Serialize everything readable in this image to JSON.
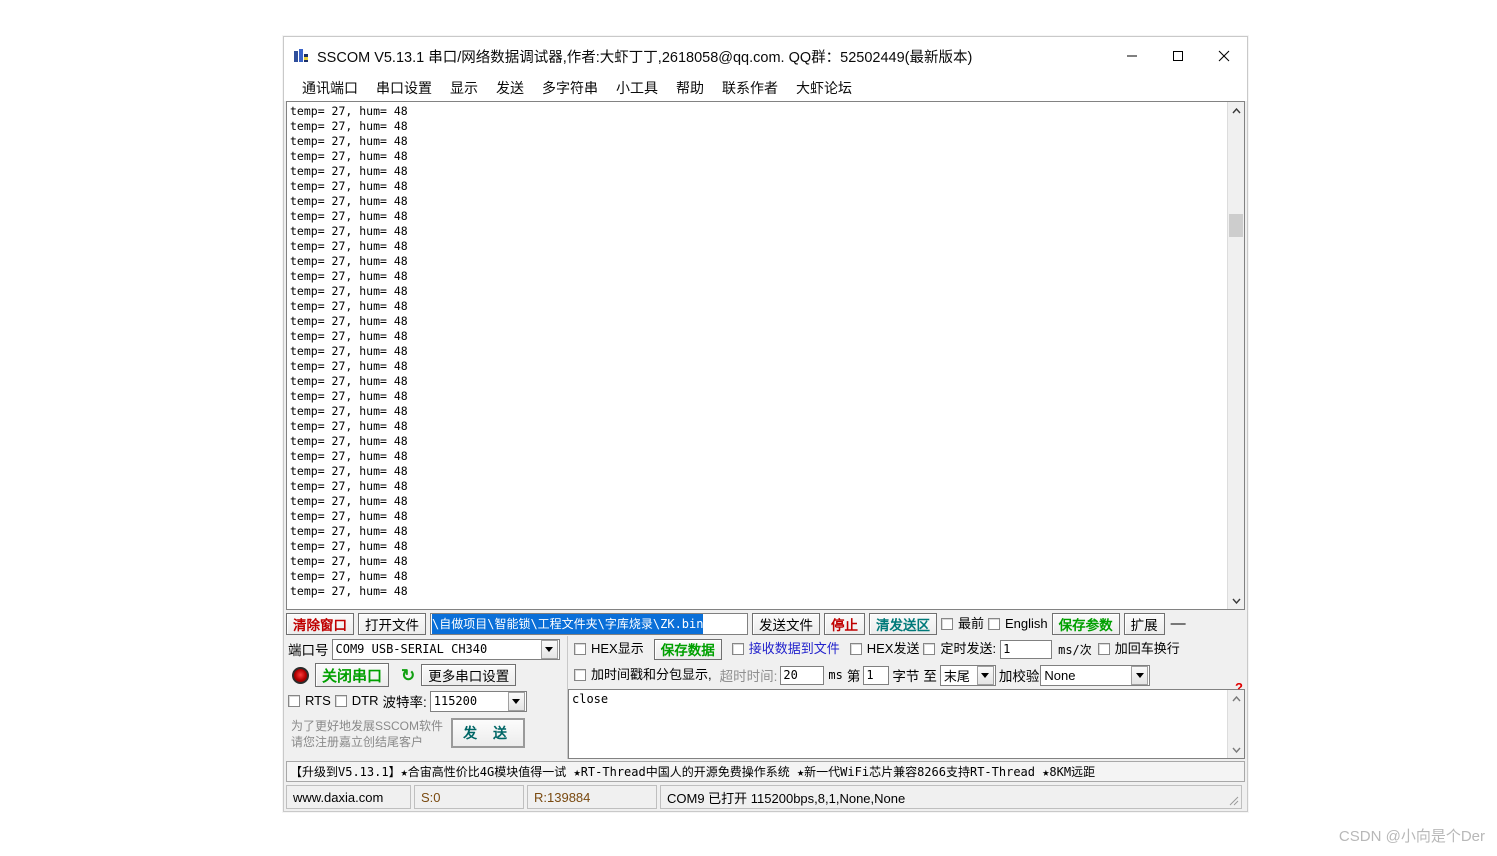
{
  "window": {
    "title": "SSCOM V5.13.1 串口/网络数据调试器,作者:大虾丁丁,2618058@qq.com. QQ群：52502449(最新版本)",
    "minimize": "−",
    "maximize": "□",
    "close": "✕"
  },
  "menu": {
    "items": [
      {
        "label": "通讯端口"
      },
      {
        "label": "串口设置"
      },
      {
        "label": "显示"
      },
      {
        "label": "发送"
      },
      {
        "label": "多字符串"
      },
      {
        "label": "小工具"
      },
      {
        "label": "帮助"
      },
      {
        "label": "联系作者"
      },
      {
        "label": "大虾论坛"
      }
    ]
  },
  "receive": {
    "line_text": "temp= 27, hum= 48",
    "line_count": 33,
    "scroll": {
      "up_arrow": "⌃",
      "down_arrow": "⌄",
      "thumb_top_pct": 20,
      "thumb_height_pct": 5
    }
  },
  "toolbar": {
    "clear_window": "清除窗口",
    "open_file": "打开文件",
    "file_path": "\\自做项目\\智能锁\\工程文件夹\\字库烧录\\ZK.bin",
    "send_file": "发送文件",
    "stop": "停止",
    "clear_send": "清发送区",
    "topmost": "最前",
    "english": "English",
    "save_params": "保存参数",
    "extend": "扩展",
    "collapse": "—"
  },
  "serial": {
    "port_label": "端口号",
    "port_value": "COM9  USB-SERIAL CH340",
    "close_port": "关闭串口",
    "more_settings": "更多串口设置",
    "rts": "RTS",
    "dtr": "DTR",
    "baud_label": "波特率:",
    "baud_value": "115200",
    "promo_line1": "为了更好地发展SSCOM软件",
    "promo_line2": "请您注册嘉立创结尾客户",
    "send_button": "发 送"
  },
  "options": {
    "hex_display": "HEX显示",
    "save_data": "保存数据",
    "recv_to_file": "接收数据到文件",
    "hex_send": "HEX发送",
    "timed_send": "定时发送:",
    "timed_value": "1",
    "timed_unit": "ms/次",
    "add_crlf": "加回车换行",
    "timestamp_pack": "加时间戳和分包显示,",
    "timeout_label": "超时时间:",
    "timeout_value": "20",
    "timeout_unit": "ms",
    "byte_prefix": "第",
    "byte_value": "1",
    "byte_mid": "字节",
    "byte_to": "至",
    "byte_end": "末尾",
    "checksum_label": "加校验",
    "checksum_value": "None",
    "question_mark": "?"
  },
  "send_area": {
    "text": "close"
  },
  "ad_strip": {
    "text": "【升级到V5.13.1】★合宙高性价比4G模块值得一试  ★RT-Thread中国人的开源免费操作系统  ★新一代WiFi芯片兼容8266支持RT-Thread ★8KM远距"
  },
  "status": {
    "site": "www.daxia.com",
    "sent": "S:0",
    "received": "R:139884",
    "connection": "COM9 已打开  115200bps,8,1,None,None"
  },
  "watermark": {
    "text": "CSDN @小向是个Der"
  },
  "colors": {
    "accent_blue": "#0a6fd8",
    "red": "#c00000",
    "teal": "#007a7a",
    "green": "#00a000",
    "brown": "#7a4a10"
  }
}
